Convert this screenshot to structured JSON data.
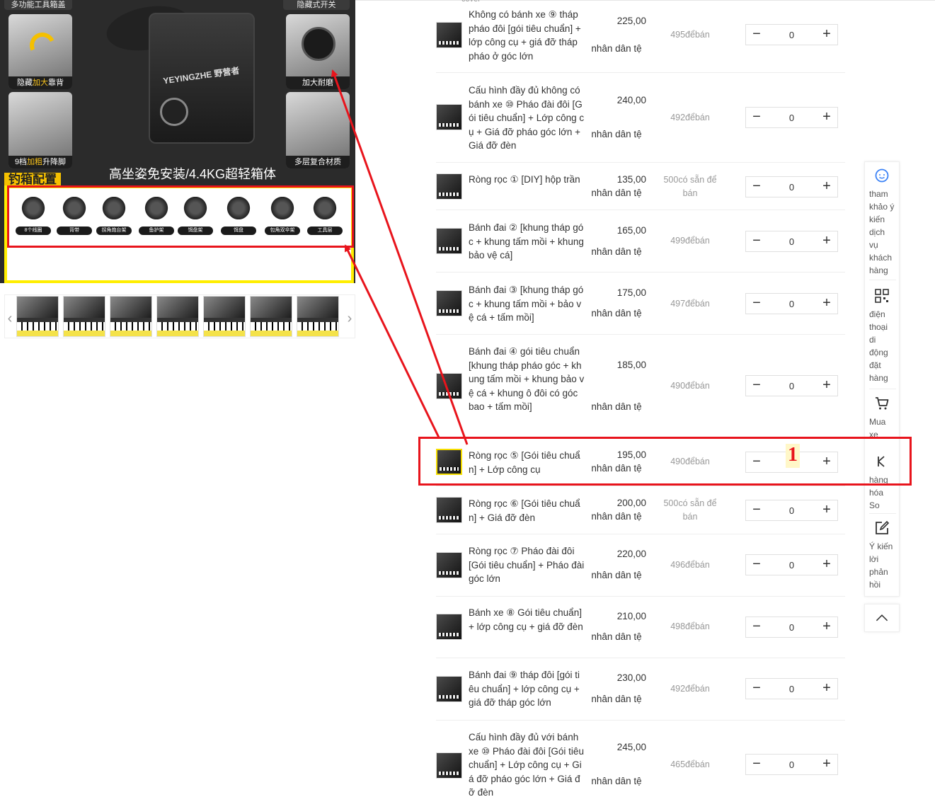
{
  "top_peek": "cover",
  "gallery": {
    "top_left_label": "多功能工具箱盖",
    "top_right_label": "隐藏式开关",
    "card_1": {
      "pre": "隐藏",
      "hl": "加大",
      "post": "靠背"
    },
    "card_2": "加大耐磨",
    "card_3": {
      "pre": "9档",
      "hl": "加粗",
      "post": "升降脚"
    },
    "card_4": "多层复合材质",
    "brand": "YEYINGZHE 野营者",
    "slogan": "高坐姿免安装/4.4KG超轻箱体",
    "config_label": "钓箱配置",
    "accessories": [
      "8个线圈",
      "背带",
      "拐角炮台架",
      "鱼护架",
      "饵盘架",
      "饵盘",
      "包角双伞架",
      "工具层"
    ]
  },
  "thumbnails": {
    "prev": "‹",
    "next": "›",
    "count": 7
  },
  "annotation": {
    "number": "1",
    "colors": {
      "red": "#e8141c",
      "yellow": "#ffee00"
    }
  },
  "unit_label": "nhân dân tệ",
  "skus": [
    {
      "name": "Không có bánh xe ⑨ tháp pháo đôi [gói tiêu chuẩn] + lớp công cụ + giá đỡ tháp pháo ở góc lớn",
      "price": "225,00",
      "stock": "495đểbán",
      "qty": "0"
    },
    {
      "name": "Cấu hình đầy đủ không có bánh xe ⑩ Pháo đài đôi [Gói tiêu chuẩn] + Lớp công cụ + Giá đỡ pháo góc lớn + Giá đỡ đèn",
      "price": "240,00",
      "stock": "492đểbán",
      "qty": "0"
    },
    {
      "name": "Ròng rọc ① [DIY] hộp trần",
      "price": "135,00",
      "stock": "500có sẵn để bán",
      "qty": "0"
    },
    {
      "name": "Bánh đai ② [khung tháp góc + khung tấm mồi + khung bảo vệ cá]",
      "price": "165,00",
      "stock": "499đểbán",
      "qty": "0"
    },
    {
      "name": "Bánh đai ③ [khung tháp góc + khung tấm mồi + bảo vệ cá + tấm mồi]",
      "price": "175,00",
      "stock": "497đểbán",
      "qty": "0"
    },
    {
      "name": "Bánh đai ④ gói tiêu chuẩn [khung tháp pháo góc + khung tấm mồi + khung bảo vệ cá + khung ô đôi có góc bao + tấm mồi]",
      "price": "185,00",
      "stock": "490đểbán",
      "qty": "0"
    },
    {
      "name": "Ròng rọc ⑤ [Gói tiêu chuẩn] + Lớp công cụ",
      "price": "195,00",
      "stock": "490đểbán",
      "qty": "0"
    },
    {
      "name": "Ròng rọc ⑥ [Gói tiêu chuẩn] + Giá đỡ đèn",
      "price": "200,00",
      "stock": "500có sẵn để bán",
      "qty": "0"
    },
    {
      "name": "Ròng rọc ⑦ Pháo đài đôi [Gói tiêu chuẩn] + Pháo đài góc lớn",
      "price": "220,00",
      "stock": "496đểbán",
      "qty": "0"
    },
    {
      "name": "Bánh xe ⑧ Gói tiêu chuẩn] + lớp công cụ + giá đỡ đèn",
      "price": "210,00",
      "stock": "498đểbán",
      "qty": "0"
    },
    {
      "name": "Bánh đai ⑨ tháp đôi [gói tiêu chuẩn] + lớp công cụ + giá đỡ tháp góc lớn",
      "price": "230,00",
      "stock": "492đểbán",
      "qty": "0"
    },
    {
      "name": "Cấu hình đầy đủ với bánh xe ⑩ Pháo đài đôi [Gói tiêu chuẩn] + Lớp công cụ + Giá đỡ pháo góc lớn + Giá đỡ đèn",
      "price": "245,00",
      "stock": "465đểbán",
      "qty": "0"
    }
  ],
  "stepper": {
    "minus": "−",
    "plus": "+"
  },
  "sidebar": {
    "items": [
      {
        "label": "tham khảo ý kiến dịch vụ khách hàng",
        "icon": "customer-service-icon"
      },
      {
        "label": "điện thoại di động đặt hàng",
        "icon": "qr-code-icon"
      },
      {
        "label": "Mua xe",
        "icon": "cart-icon"
      },
      {
        "label": "hàng hóa So",
        "icon": "compare-icon"
      },
      {
        "label": "Ý kiến lời phản hồi",
        "icon": "feedback-icon"
      }
    ],
    "back_top_icon": "chevron-up-icon"
  }
}
